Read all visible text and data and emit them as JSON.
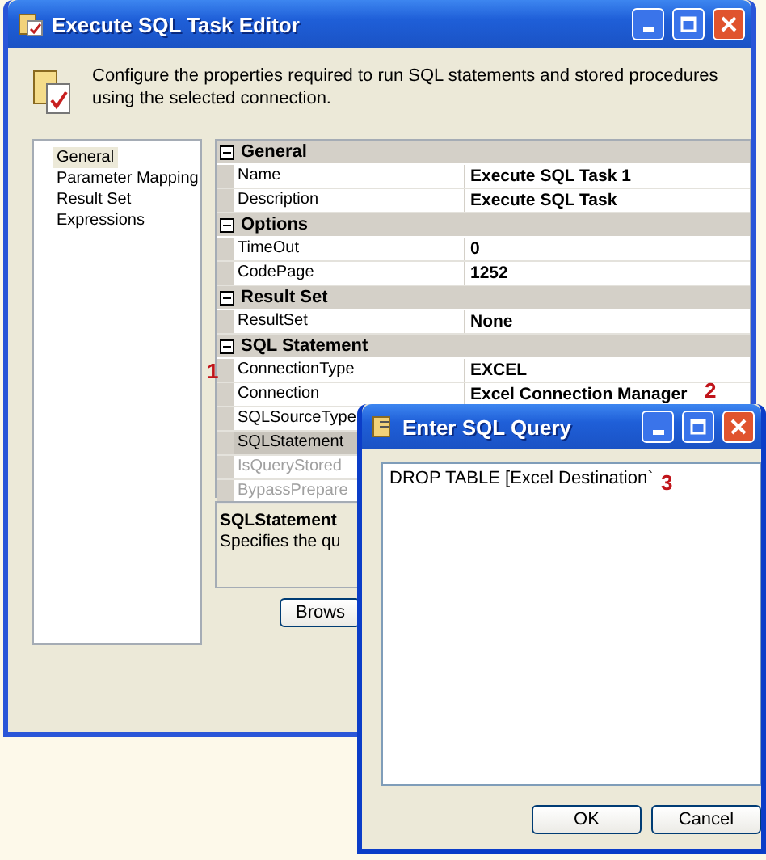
{
  "window": {
    "title": "Execute SQL Task Editor",
    "description": "Configure the properties required to run SQL statements and stored procedures using the selected connection."
  },
  "nav": [
    {
      "label": "General",
      "selected": true
    },
    {
      "label": "Parameter Mapping",
      "selected": false
    },
    {
      "label": "Result Set",
      "selected": false
    },
    {
      "label": "Expressions",
      "selected": false
    }
  ],
  "properties": [
    {
      "category": "General",
      "expanded": true,
      "rows": [
        {
          "name": "Name",
          "value": "Execute SQL Task 1",
          "disabled": false,
          "selected": false
        },
        {
          "name": "Description",
          "value": "Execute SQL Task",
          "disabled": false,
          "selected": false
        }
      ]
    },
    {
      "category": "Options",
      "expanded": true,
      "rows": [
        {
          "name": "TimeOut",
          "value": "0",
          "disabled": false,
          "selected": false
        },
        {
          "name": "CodePage",
          "value": "1252",
          "disabled": false,
          "selected": false
        }
      ]
    },
    {
      "category": "Result Set",
      "expanded": true,
      "rows": [
        {
          "name": "ResultSet",
          "value": "None",
          "disabled": false,
          "selected": false
        }
      ]
    },
    {
      "category": "SQL Statement",
      "expanded": true,
      "rows": [
        {
          "name": "ConnectionType",
          "value": "EXCEL",
          "disabled": false,
          "selected": false
        },
        {
          "name": "Connection",
          "value": "Excel Connection Manager",
          "disabled": false,
          "selected": false
        },
        {
          "name": "SQLSourceType",
          "disabled": false,
          "selected": false
        },
        {
          "name": "SQLStatement",
          "disabled": false,
          "selected": true
        },
        {
          "name": "IsQueryStored",
          "disabled": true,
          "selected": false
        },
        {
          "name": "BypassPrepare",
          "disabled": true,
          "selected": false
        }
      ]
    }
  ],
  "help": {
    "title": "SQLStatement",
    "text": "Specifies the qu"
  },
  "buttons": [
    "Brows"
  ],
  "dialog": {
    "title": "Enter SQL Query",
    "query": "DROP TABLE [Excel Destination`",
    "buttons": [
      "OK",
      "Cancel"
    ]
  },
  "annotations": [
    "1",
    "2",
    "3"
  ]
}
